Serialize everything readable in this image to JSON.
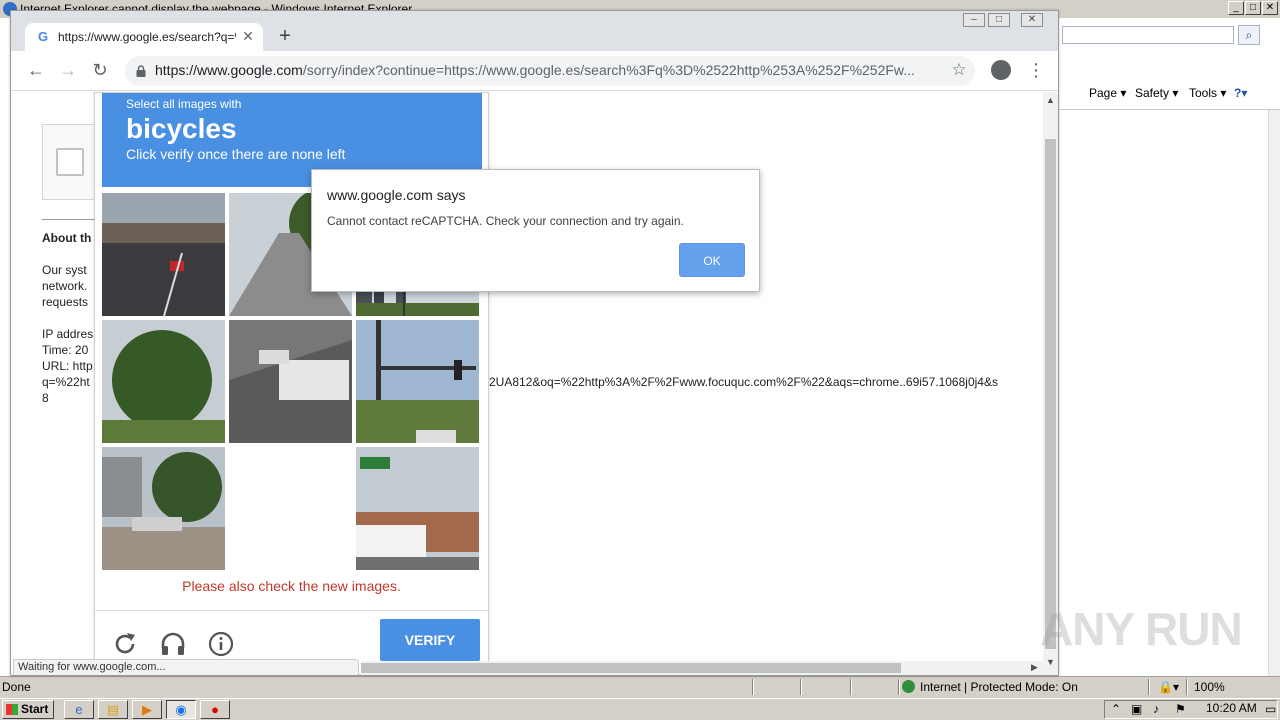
{
  "ie": {
    "title": "Internet Explorer cannot display the webpage - Windows Internet Explorer",
    "window_buttons": [
      "_",
      "□",
      "✕"
    ],
    "search_button_icon": "search-icon",
    "commands": [
      "Page ▾",
      "Safety ▾",
      "Tools ▾",
      "?▾"
    ],
    "status_done": "Done",
    "status_zone": "Internet | Protected Mode: On",
    "status_zoom": "100%"
  },
  "taskbar": {
    "start_label": "Start",
    "clock": "10:20 AM"
  },
  "chrome": {
    "tab_title": "https://www.google.es/search?q=%",
    "url_host": "https://www.google.com",
    "url_path": "/sorry/index?continue=https://www.google.es/search%3Fq%3D%2522http%253A%252F%252Fw...",
    "window_buttons": [
      "–",
      "□",
      "✕"
    ]
  },
  "sorry_page": {
    "about": "About th",
    "lines": [
      "Our syst",
      "network.",
      "requests",
      "",
      "IP addres",
      "Time: 20",
      "URL: http",
      "q=%22ht",
      "8"
    ],
    "url_tail": "2UA812&oq=%22http%3A%2F%2Fwww.focuquc.com%2F%22&aqs=chrome..69i57.1068j0j4&s"
  },
  "page_status": "Waiting for www.google.com...",
  "recaptcha": {
    "select_text": "Select all images with",
    "object": "bicycles",
    "instruction": "Click verify once there are none left",
    "error": "Please also check the new images.",
    "verify_label": "VERIFY",
    "tools": [
      "reload-icon",
      "headphones-icon",
      "info-icon"
    ]
  },
  "alert": {
    "origin": "www.google.com says",
    "message": "Cannot contact reCAPTCHA. Check your connection and try again.",
    "ok_label": "OK"
  },
  "watermark": "ANY RUN"
}
